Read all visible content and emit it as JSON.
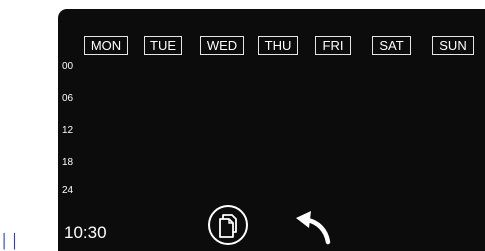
{
  "edge_text": "││",
  "days": [
    "MON",
    "TUE",
    "WED",
    "THU",
    "FRI",
    "SAT",
    "SUN"
  ],
  "hours": [
    "00",
    "06",
    "12",
    "18",
    "24"
  ],
  "clock": "10:30",
  "icons": {
    "copy": "copy-icon",
    "back": "back-arrow-icon"
  },
  "colors": {
    "background": "#0c0c0c",
    "text": "#ffffff",
    "edge_mark": "#2b3bd0"
  }
}
